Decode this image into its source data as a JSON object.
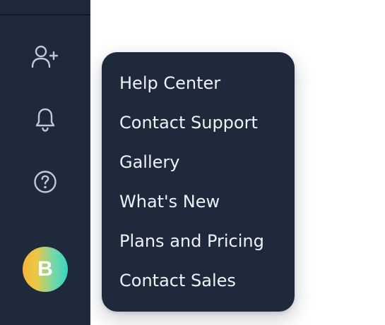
{
  "sidebar": {
    "buttons": [
      {
        "icon": "add-user-icon"
      },
      {
        "icon": "bell-icon"
      },
      {
        "icon": "help-circle-icon"
      }
    ],
    "avatar": {
      "initial": "B",
      "colors": [
        "#f6b33a",
        "#34d6c4"
      ]
    }
  },
  "help_menu": {
    "items": [
      {
        "label": "Help Center"
      },
      {
        "label": "Contact Support"
      },
      {
        "label": "Gallery"
      },
      {
        "label": "What's New"
      },
      {
        "label": "Plans and Pricing"
      },
      {
        "label": "Contact Sales"
      }
    ]
  },
  "colors": {
    "sidebar_background": "#1e293b",
    "menu_background": "#1e293b",
    "menu_text": "#eef2f7",
    "icon_stroke": "#c0c9d6",
    "page_background": "#ffffff"
  }
}
